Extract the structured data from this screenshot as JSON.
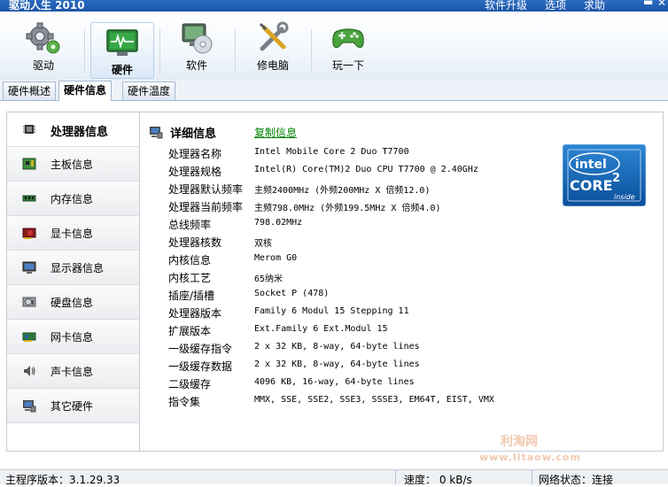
{
  "window": {
    "title": "驱动人生 2010",
    "menu": [
      "软件升级",
      "选项",
      "求助"
    ],
    "minimize": "▬",
    "close": "✕"
  },
  "toolbar": {
    "items": [
      {
        "label": "驱动",
        "icon": "gear-icon"
      },
      {
        "label": "硬件",
        "icon": "monitor-pulse-icon"
      },
      {
        "label": "软件",
        "icon": "cd-icon"
      },
      {
        "label": "修电脑",
        "icon": "tools-icon"
      },
      {
        "label": "玩一下",
        "icon": "gamepad-icon"
      }
    ],
    "active": "硬件"
  },
  "tabs": [
    "硬件概述",
    "硬件信息",
    "硬件温度"
  ],
  "active_tab": "硬件信息",
  "sidebar": {
    "items": [
      {
        "label": "处理器信息",
        "icon": "cpu-icon"
      },
      {
        "label": "主板信息",
        "icon": "motherboard-icon"
      },
      {
        "label": "内存信息",
        "icon": "memory-icon"
      },
      {
        "label": "显卡信息",
        "icon": "graphics-card-icon"
      },
      {
        "label": "显示器信息",
        "icon": "display-icon"
      },
      {
        "label": "硬盘信息",
        "icon": "harddisk-icon"
      },
      {
        "label": "网卡信息",
        "icon": "network-card-icon"
      },
      {
        "label": "声卡信息",
        "icon": "speaker-icon"
      },
      {
        "label": "其它硬件",
        "icon": "computer-icon"
      }
    ],
    "active": "处理器信息"
  },
  "detail": {
    "title": "详细信息",
    "copy_label": "复制信息",
    "rows": [
      {
        "label": "处理器名称",
        "value": "Intel Mobile Core 2 Duo T7700"
      },
      {
        "label": "处理器规格",
        "value": "Intel(R) Core(TM)2 Duo CPU T7700 @ 2.40GHz"
      },
      {
        "label": "处理器默认频率",
        "value": "主频2400MHz (外频200MHz X 倍频12.0)"
      },
      {
        "label": "处理器当前频率",
        "value": "主频798.0MHz (外频199.5MHz X 倍频4.0)"
      },
      {
        "label": "总线频率",
        "value": "798.02MHz"
      },
      {
        "label": "处理器核数",
        "value": "双核"
      },
      {
        "label": "内核信息",
        "value": "Merom G0"
      },
      {
        "label": "内核工艺",
        "value": "65纳米"
      },
      {
        "label": "插座/插槽",
        "value": "Socket P (478)"
      },
      {
        "label": "处理器版本",
        "value": "Family 6 Modul 15 Stepping 11"
      },
      {
        "label": "扩展版本",
        "value": "Ext.Family 6 Ext.Modul 15"
      },
      {
        "label": "一级缓存指令",
        "value": "2 x 32 KB, 8-way, 64-byte lines"
      },
      {
        "label": "一级缓存数据",
        "value": "2 x 32 KB, 8-way, 64-byte lines"
      },
      {
        "label": "二级缓存",
        "value": "4096 KB, 16-way, 64-byte lines"
      },
      {
        "label": "指令集",
        "value": "MMX, SSE, SSE2, SSE3, SSSE3, EM64T, EIST, VMX"
      }
    ],
    "logo": {
      "brand": "intel",
      "product": "CORE",
      "superscript": "2",
      "tag": "inside"
    }
  },
  "watermark": {
    "line1": "利淘网",
    "line2": "www.litaow.com"
  },
  "status": {
    "version": "主程序版本：3.1.29.33",
    "speed": "速度： 0 kB/s",
    "network": "网络状态：连接"
  },
  "colors": {
    "link": "#008000",
    "accent": "#1b55a8",
    "logo_blue": "#0860a8"
  }
}
